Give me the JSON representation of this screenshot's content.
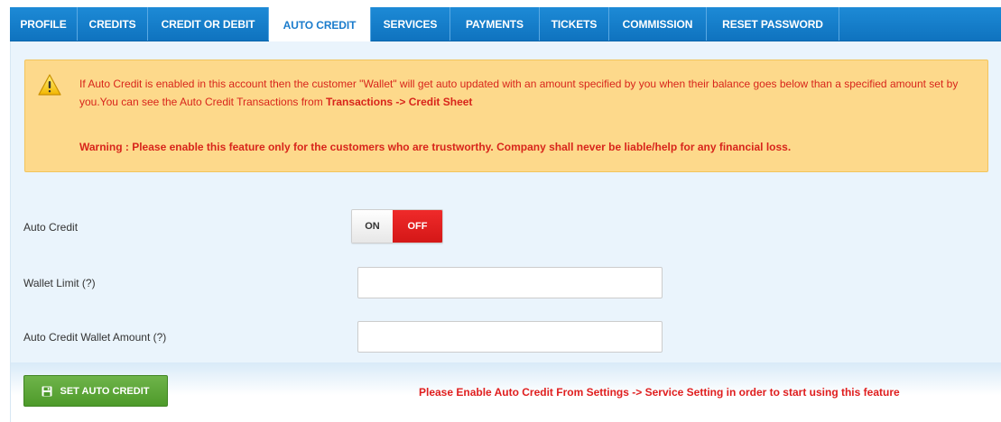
{
  "tabs": [
    {
      "label": "PROFILE",
      "active": false
    },
    {
      "label": "CREDITS",
      "active": false
    },
    {
      "label": "CREDIT OR DEBIT",
      "active": false
    },
    {
      "label": "AUTO CREDIT",
      "active": true
    },
    {
      "label": "SERVICES",
      "active": false
    },
    {
      "label": "PAYMENTS",
      "active": false
    },
    {
      "label": "TICKETS",
      "active": false
    },
    {
      "label": "COMMISSION",
      "active": false
    },
    {
      "label": "RESET PASSWORD",
      "active": false
    }
  ],
  "alert": {
    "icon": "warning-icon",
    "text_before": "If Auto Credit is enabled in this account then the customer \"Wallet\" will get auto updated with an amount specified by you when their balance goes below than a specified amount set by you.You can see the Auto Credit Transactions from ",
    "link_text": "Transactions -> Credit Sheet",
    "warning": "Warning : Please enable this feature only for the customers who are trustworthy. Company shall never be liable/help for any financial loss."
  },
  "form": {
    "auto_credit_label": "Auto Credit",
    "toggle_on_label": "ON",
    "toggle_off_label": "OFF",
    "toggle_state": "OFF",
    "wallet_limit_label": "Wallet Limit (?)",
    "wallet_limit_value": "",
    "auto_credit_amount_label": "Auto Credit Wallet Amount (?)",
    "auto_credit_amount_value": ""
  },
  "footer": {
    "button_label": "SET AUTO CREDIT",
    "notice": "Please Enable Auto Credit From Settings -> Service Setting in order to start using this feature"
  },
  "colors": {
    "tab_bar": "#1281cf",
    "alert_bg": "#fdd98b",
    "alert_text": "#d8251b",
    "toggle_off": "#e02020",
    "button_green": "#5ea83a"
  }
}
